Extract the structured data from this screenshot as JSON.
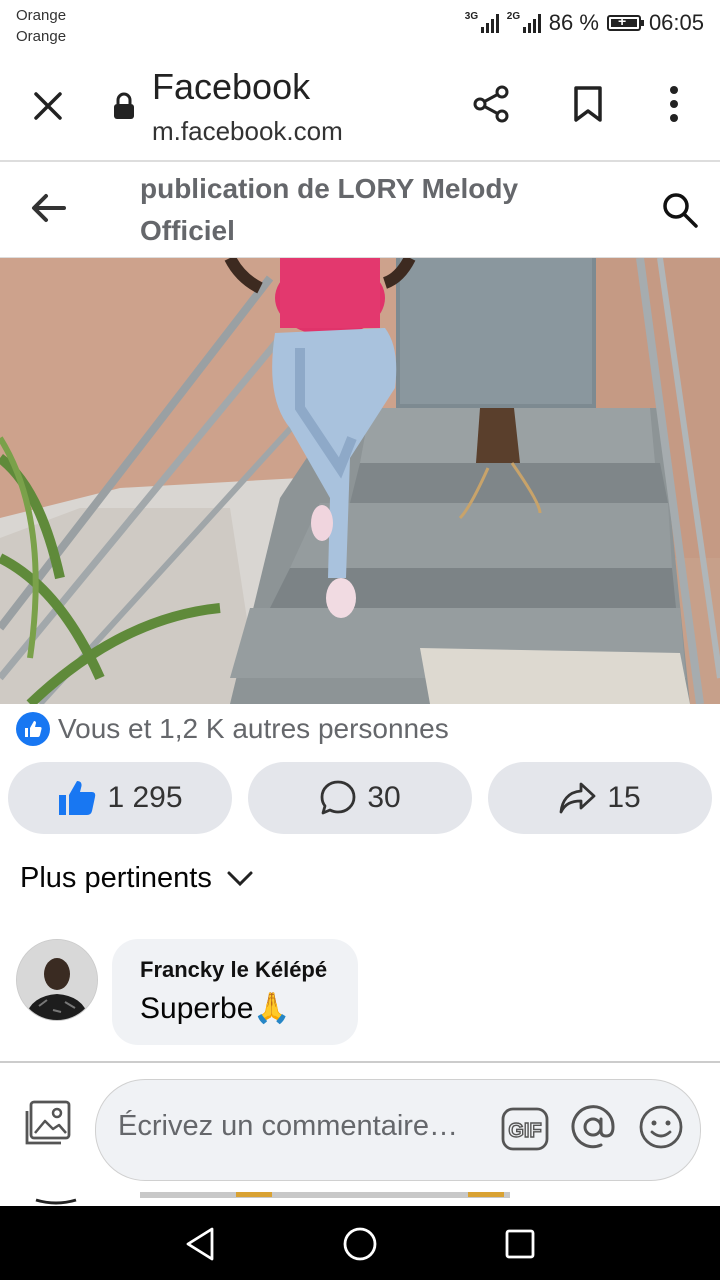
{
  "status": {
    "carrier_line1": "Orange",
    "carrier_line2": "Orange",
    "network1": "3G",
    "network2": "2G",
    "battery_text": "86 %",
    "battery_level": 0.86,
    "time": "06:05"
  },
  "browser": {
    "title": "Facebook",
    "url": "m.facebook.com",
    "icons": [
      "close-icon",
      "lock-icon",
      "share-icon",
      "bookmark-icon",
      "more-vert-icon"
    ]
  },
  "header": {
    "title": "publication de LORY Melody Officiel",
    "icons": [
      "back-arrow-icon",
      "search-icon"
    ]
  },
  "reactions": {
    "summary": "Vous et 1,2 K autres personnes"
  },
  "actions": {
    "likes": "1 295",
    "comments": "30",
    "shares": "15"
  },
  "sort": {
    "label": "Plus pertinents"
  },
  "comment": {
    "author": "Francky le Kélépé",
    "text": "Superbe🙏"
  },
  "composer": {
    "placeholder": "Écrivez un commentaire…",
    "gif_label": "GIF"
  },
  "colors": {
    "accent": "#1877f2",
    "pill_bg": "#e4e6eb",
    "bubble_bg": "#f0f2f5"
  }
}
